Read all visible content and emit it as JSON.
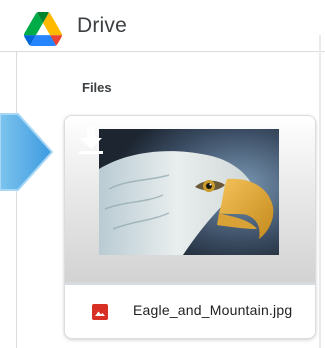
{
  "header": {
    "app_name": "Drive",
    "logo_icon": "google-drive-logo"
  },
  "section": {
    "title": "Files"
  },
  "file_card": {
    "file_name": "Eagle_and_Mountain.jpg",
    "file_type_icon": "image-file-icon",
    "file_type_color": "#d93025",
    "action_icon": "download-icon",
    "thumbnail_subject": "eagle-photo"
  },
  "pointer": {
    "icon": "pointer-arrow-icon",
    "color": "#4da6e0"
  },
  "colors": {
    "drive_green": "#1ea362",
    "drive_yellow": "#ffba00",
    "drive_blue": "#4285f4",
    "border": "#dadce0",
    "text": "#3c4043"
  }
}
